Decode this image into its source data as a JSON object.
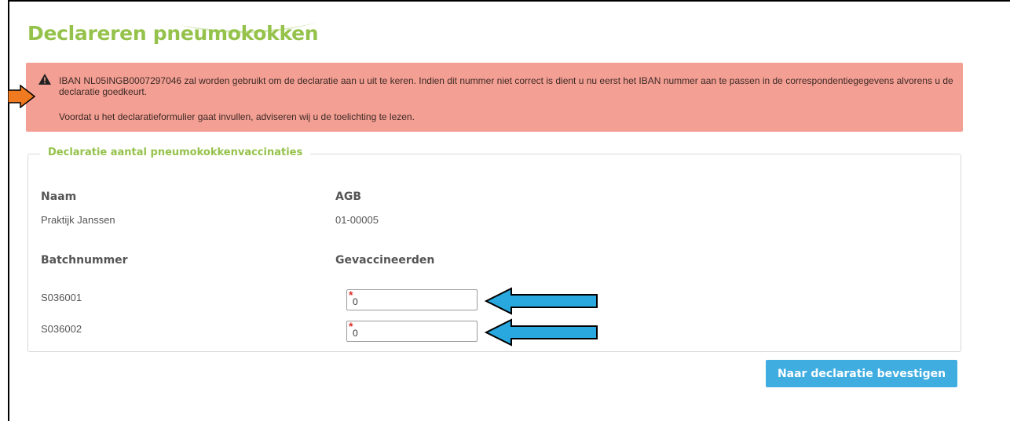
{
  "page": {
    "title": "Declareren pneumokokken"
  },
  "alert": {
    "message": "IBAN NL05INGB0007297046 zal worden gebruikt om de declaratie aan u uit te keren. Indien dit nummer niet correct is dient u nu eerst het IBAN nummer aan te passen in de correspondentiegegevens alvorens u de declaratie goedkeurt.",
    "advice": "Voordat u het declaratieformulier gaat invullen, adviseren wij u de toelichting te lezen.",
    "icon": "warning-icon",
    "background": "#f49f93"
  },
  "form": {
    "legend": "Declaratie aantal pneumokokkenvaccinaties",
    "name_label": "Naam",
    "name_value": "Praktijk Janssen",
    "agb_label": "AGB",
    "agb_value": "01-00005",
    "batch_label": "Batchnummer",
    "vaccinated_label": "Gevaccineerden",
    "rows": [
      {
        "batch": "S036001",
        "value": "0",
        "required_mark": "*"
      },
      {
        "batch": "S036002",
        "value": "0",
        "required_mark": "*"
      }
    ]
  },
  "actions": {
    "submit_label": "Naar declaratie bevestigen"
  },
  "colors": {
    "accent_green": "#95c24b",
    "button_blue": "#40ade1",
    "annotation_orange": "#f07a1f",
    "annotation_blue": "#29a8e0"
  }
}
